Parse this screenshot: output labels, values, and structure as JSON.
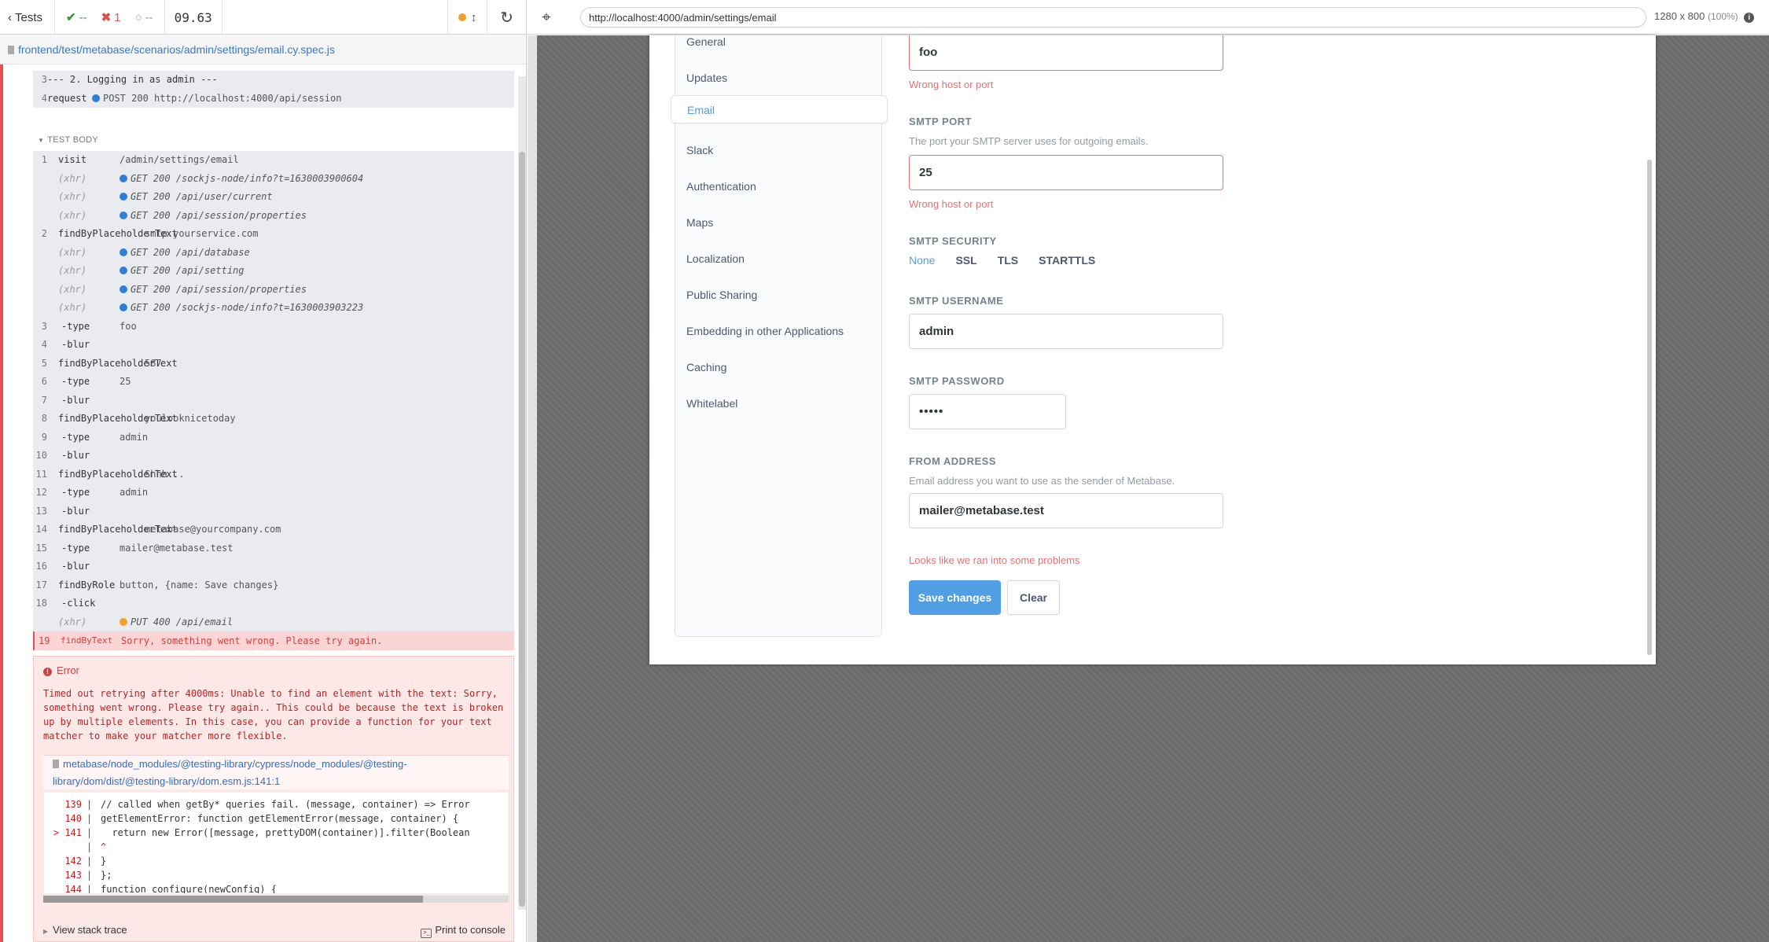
{
  "topbar": {
    "tests_label": "Tests",
    "passed": "--",
    "failed": "1",
    "pending": "--",
    "duration": "09.63",
    "url": "http://localhost:4000/admin/settings/email",
    "viewport_size": "1280 x 800",
    "viewport_pct": "(100%)"
  },
  "reporter": {
    "spec_path": "frontend/test/metabase/scenarios/admin/settings/email.cy.spec.js",
    "test_body_label": "TEST BODY",
    "before_commands": [
      {
        "num": "3",
        "name": "--- 2. Logging in as admin ---",
        "msg": ""
      },
      {
        "num": "4",
        "name": "request",
        "msg": "POST 200 http://localhost:4000/api/session"
      }
    ],
    "commands": [
      {
        "num": "1",
        "name": "visit",
        "msg": "/admin/settings/email"
      },
      {
        "num": "",
        "name": "(xhr)",
        "msg": "GET 200 /sockjs-node/info?t=1630003900604"
      },
      {
        "num": "",
        "name": "(xhr)",
        "msg": "GET 200 /api/user/current"
      },
      {
        "num": "",
        "name": "(xhr)",
        "msg": "GET 200 /api/session/properties"
      },
      {
        "num": "2",
        "name": "findByPlaceholderText",
        "msg": "smtp.yourservice.com"
      },
      {
        "num": "",
        "name": "(xhr)",
        "msg": "GET 200 /api/database"
      },
      {
        "num": "",
        "name": "(xhr)",
        "msg": "GET 200 /api/setting"
      },
      {
        "num": "",
        "name": "(xhr)",
        "msg": "GET 200 /api/session/properties"
      },
      {
        "num": "",
        "name": "(xhr)",
        "msg": "GET 200 /sockjs-node/info?t=1630003903223"
      },
      {
        "num": "3",
        "name": "-type",
        "msg": "foo"
      },
      {
        "num": "4",
        "name": "-blur",
        "msg": ""
      },
      {
        "num": "5",
        "name": "findByPlaceholderText",
        "msg": "587"
      },
      {
        "num": "6",
        "name": "-type",
        "msg": "25"
      },
      {
        "num": "7",
        "name": "-blur",
        "msg": ""
      },
      {
        "num": "8",
        "name": "findByPlaceholderText",
        "msg": "youlooknicetoday"
      },
      {
        "num": "9",
        "name": "-type",
        "msg": "admin"
      },
      {
        "num": "10",
        "name": "-blur",
        "msg": ""
      },
      {
        "num": "11",
        "name": "findByPlaceholderText",
        "msg": "Shhh..."
      },
      {
        "num": "12",
        "name": "-type",
        "msg": "admin"
      },
      {
        "num": "13",
        "name": "-blur",
        "msg": ""
      },
      {
        "num": "14",
        "name": "findByPlaceholderText",
        "msg": "metabase@yourcompany.com"
      },
      {
        "num": "15",
        "name": "-type",
        "msg": "mailer@metabase.test"
      },
      {
        "num": "16",
        "name": "-blur",
        "msg": ""
      },
      {
        "num": "17",
        "name": "findByRole",
        "msg": "button, {name: Save changes}"
      },
      {
        "num": "18",
        "name": "-click",
        "msg": ""
      },
      {
        "num": "",
        "name": "(xhr)",
        "msg": "PUT 400 /api/email"
      }
    ],
    "failed_command": {
      "num": "19",
      "name": "findByText",
      "msg": "Sorry, something went wrong. Please try again."
    },
    "error": {
      "title": "Error",
      "message": "Timed out retrying after 4000ms: Unable to find an element with the text: Sorry, something went wrong. Please try again.. This could be because the text is broken up by multiple elements. In this case, you can provide a function for your text matcher to make your matcher more flexible.",
      "file": "metabase/node_modules/@testing-library/cypress/node_modules/@testing-library/dom/dist/@testing-library/dom.esm.js:141:1",
      "code_lines": [
        {
          "ln": "139",
          "bar": "|",
          "src": "// called when getBy* queries fail. (message, container) => Error"
        },
        {
          "ln": "140",
          "bar": "|",
          "src": "getElementError: function getElementError(message, container) {"
        },
        {
          "ln": "> 141",
          "bar": "|",
          "src": "  return new Error([message, prettyDOM(container)].filter(Boolean"
        },
        {
          "ln": "",
          "bar": "|",
          "src": "^"
        },
        {
          "ln": "142",
          "bar": "|",
          "src": "}"
        },
        {
          "ln": "143",
          "bar": "|",
          "src": "};"
        },
        {
          "ln": "144",
          "bar": "|",
          "src": "function configure(newConfig) {"
        }
      ],
      "stack_trace_label": "View stack trace",
      "print_console_label": "Print to console"
    }
  },
  "app": {
    "nav": [
      "General",
      "Updates",
      "Email",
      "Slack",
      "Authentication",
      "Maps",
      "Localization",
      "Public Sharing",
      "Embedding in other Applications",
      "Caching",
      "Whitelabel"
    ],
    "active_nav": "Email",
    "smtp_host_value": "foo",
    "smtp_host_error": "Wrong host or port",
    "smtp_port_label": "SMTP PORT",
    "smtp_port_desc": "The port your SMTP server uses for outgoing emails.",
    "smtp_port_value": "25",
    "smtp_port_error": "Wrong host or port",
    "smtp_security_label": "SMTP SECURITY",
    "security_options": [
      "None",
      "SSL",
      "TLS",
      "STARTTLS"
    ],
    "smtp_username_label": "SMTP USERNAME",
    "smtp_username_value": "admin",
    "smtp_password_label": "SMTP PASSWORD",
    "smtp_password_value": "•••••",
    "from_address_label": "FROM ADDRESS",
    "from_address_desc": "Email address you want to use as the sender of Metabase.",
    "from_address_value": "mailer@metabase.test",
    "form_error": "Looks like we ran into some problems",
    "save_label": "Save changes",
    "clear_label": "Clear"
  },
  "colors": {
    "accent": "#509ee3",
    "error": "#ed6e6e",
    "cypress_fail": "#e94f4f",
    "cypress_pass": "#3a9a3a"
  }
}
